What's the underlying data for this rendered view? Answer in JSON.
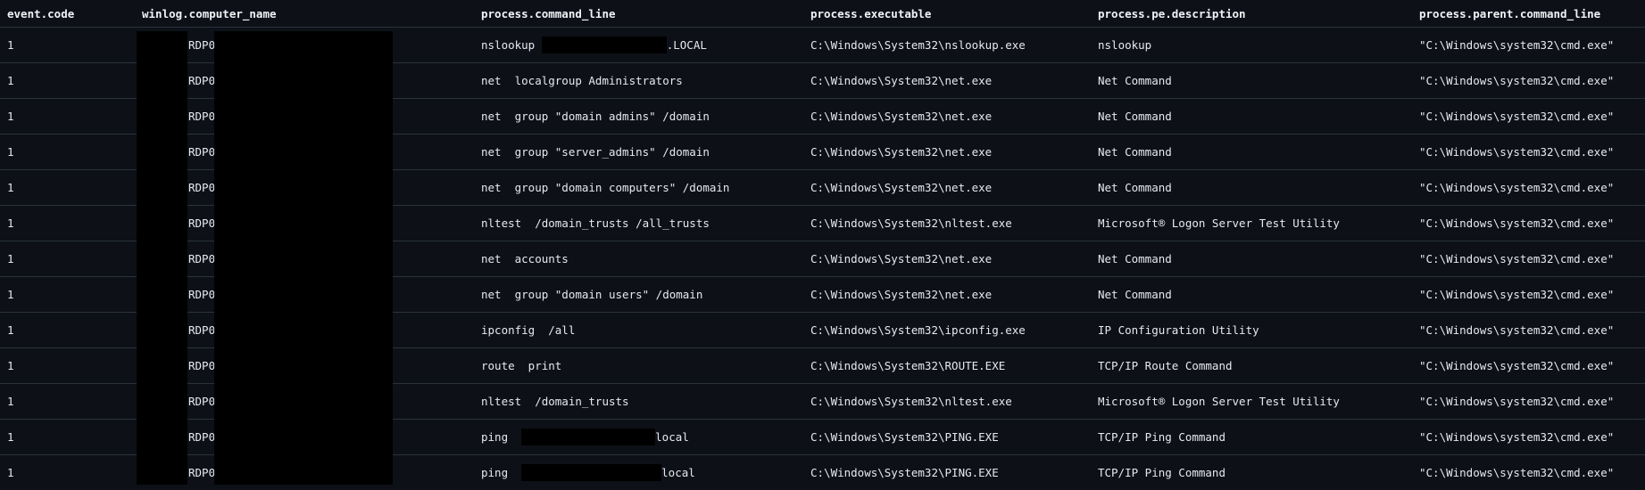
{
  "columns": [
    "event.code",
    "winlog.computer_name",
    "process.command_line",
    "process.executable",
    "process.pe.description",
    "process.parent.command_line"
  ],
  "rows": [
    {
      "event_code": "1",
      "host": "RDP0",
      "cmd_pre": "nslookup ",
      "cmd_post": ".LOCAL",
      "exe": "C:\\Windows\\System32\\nslookup.exe",
      "desc": "nslookup",
      "parent": "\"C:\\Windows\\system32\\cmd.exe\""
    },
    {
      "event_code": "1",
      "host": "RDP0",
      "cmd_pre": "net  localgroup Administrators",
      "cmd_post": "",
      "exe": "C:\\Windows\\System32\\net.exe",
      "desc": "Net Command",
      "parent": "\"C:\\Windows\\system32\\cmd.exe\""
    },
    {
      "event_code": "1",
      "host": "RDP0",
      "cmd_pre": "net  group \"domain admins\" /domain",
      "cmd_post": "",
      "exe": "C:\\Windows\\System32\\net.exe",
      "desc": "Net Command",
      "parent": "\"C:\\Windows\\system32\\cmd.exe\""
    },
    {
      "event_code": "1",
      "host": "RDP0",
      "cmd_pre": "net  group \"server_admins\" /domain",
      "cmd_post": "",
      "exe": "C:\\Windows\\System32\\net.exe",
      "desc": "Net Command",
      "parent": "\"C:\\Windows\\system32\\cmd.exe\""
    },
    {
      "event_code": "1",
      "host": "RDP0",
      "cmd_pre": "net  group \"domain computers\" /domain",
      "cmd_post": "",
      "exe": "C:\\Windows\\System32\\net.exe",
      "desc": "Net Command",
      "parent": "\"C:\\Windows\\system32\\cmd.exe\""
    },
    {
      "event_code": "1",
      "host": "RDP0",
      "cmd_pre": "nltest  /domain_trusts /all_trusts",
      "cmd_post": "",
      "exe": "C:\\Windows\\System32\\nltest.exe",
      "desc": "Microsoft® Logon Server Test Utility",
      "parent": "\"C:\\Windows\\system32\\cmd.exe\""
    },
    {
      "event_code": "1",
      "host": "RDP0",
      "cmd_pre": "net  accounts",
      "cmd_post": "",
      "exe": "C:\\Windows\\System32\\net.exe",
      "desc": "Net Command",
      "parent": "\"C:\\Windows\\system32\\cmd.exe\""
    },
    {
      "event_code": "1",
      "host": "RDP0",
      "cmd_pre": "net  group \"domain users\" /domain",
      "cmd_post": "",
      "exe": "C:\\Windows\\System32\\net.exe",
      "desc": "Net Command",
      "parent": "\"C:\\Windows\\system32\\cmd.exe\""
    },
    {
      "event_code": "1",
      "host": "RDP0",
      "cmd_pre": "ipconfig  /all",
      "cmd_post": "",
      "exe": "C:\\Windows\\System32\\ipconfig.exe",
      "desc": "IP Configuration Utility",
      "parent": "\"C:\\Windows\\system32\\cmd.exe\""
    },
    {
      "event_code": "1",
      "host": "RDP0",
      "cmd_pre": "route  print",
      "cmd_post": "",
      "exe": "C:\\Windows\\System32\\ROUTE.EXE",
      "desc": "TCP/IP Route Command",
      "parent": "\"C:\\Windows\\system32\\cmd.exe\""
    },
    {
      "event_code": "1",
      "host": "RDP0",
      "cmd_pre": "nltest  /domain_trusts",
      "cmd_post": "",
      "exe": "C:\\Windows\\System32\\nltest.exe",
      "desc": "Microsoft® Logon Server Test Utility",
      "parent": "\"C:\\Windows\\system32\\cmd.exe\""
    },
    {
      "event_code": "1",
      "host": "RDP0",
      "cmd_pre": "ping  ",
      "cmd_post": "local",
      "exe": "C:\\Windows\\System32\\PING.EXE",
      "desc": "TCP/IP Ping Command",
      "parent": "\"C:\\Windows\\system32\\cmd.exe\""
    },
    {
      "event_code": "1",
      "host": "RDP0",
      "cmd_pre": "ping  ",
      "cmd_post": "local",
      "exe": "C:\\Windows\\System32\\PING.EXE",
      "desc": "TCP/IP Ping Command",
      "parent": "\"C:\\Windows\\system32\\cmd.exe\""
    }
  ],
  "colors": {
    "background": "#0d1117",
    "text": "#e6e9ee",
    "divider": "#2b323c",
    "redaction": "#000000"
  }
}
